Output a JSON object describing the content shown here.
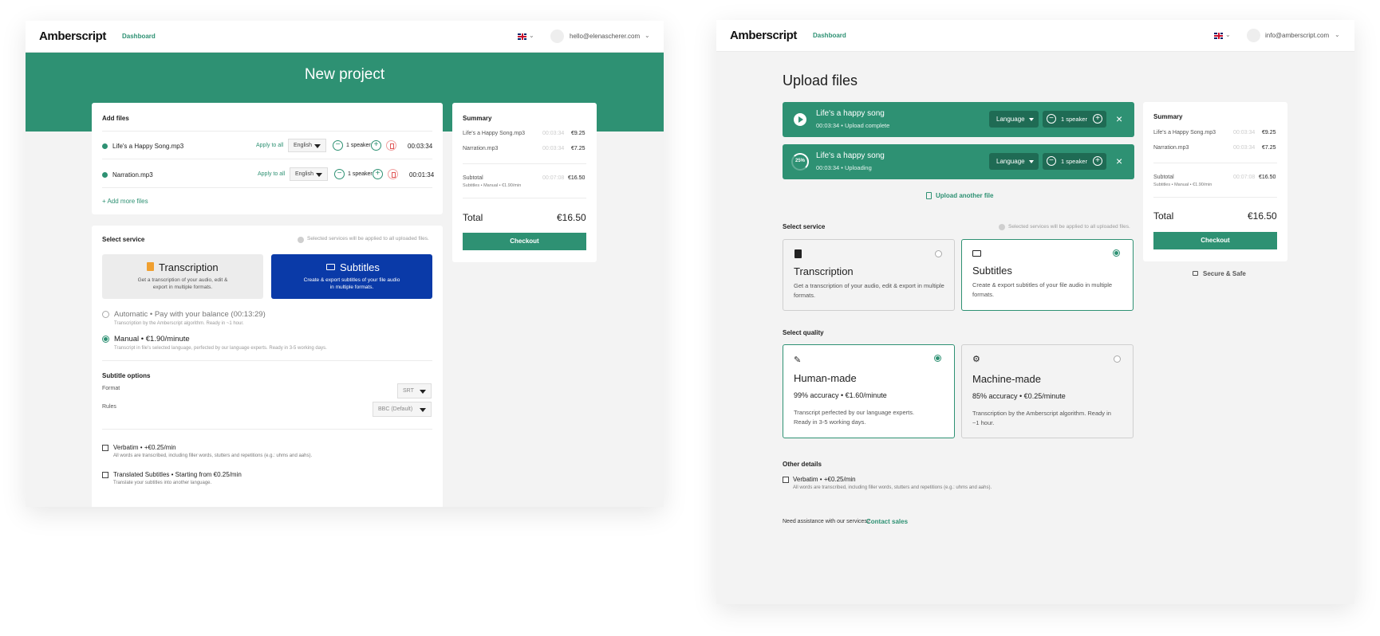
{
  "left": {
    "logo": "Amberscript",
    "nav": "Dashboard",
    "email": "hello@elenascherer.com",
    "title": "New project",
    "add_files": {
      "title": "Add files",
      "files": [
        {
          "name": "Life's a Happy Song.mp3",
          "apply": "Apply to all",
          "language": "English",
          "speaker": "1 speaker",
          "duration": "00:03:34"
        },
        {
          "name": "Narration.mp3",
          "apply": "Apply to all",
          "language": "English",
          "speaker": "1 speaker",
          "duration": "00:01:34"
        }
      ],
      "add_more": "+ Add more files"
    },
    "service": {
      "title": "Select service",
      "note": "Selected services will be applied to all uploaded files.",
      "transcription_title": "Transcription",
      "transcription_desc1": "Get a transcription of your audio, edit &",
      "transcription_desc2": "export in multiple formats.",
      "subtitles_title": "Subtitles",
      "subtitles_desc1": "Create & export subtitles of your file audio",
      "subtitles_desc2": "in multiple formats.",
      "automatic_title": "Automatic • Pay with your balance (00:13:29)",
      "automatic_desc": "Transcription by the Amberscript algorithm. Ready in ~1 hour.",
      "manual_title": "Manual • €1.90/minute",
      "manual_desc": "Transcript in file's selected language, perfected by our language experts. Ready in 3-5 working days."
    },
    "subtitle_options": {
      "title": "Subtitle options",
      "format_label": "Format",
      "format_value": "SRT",
      "rules_label": "Rules",
      "rules_value": "BBC (Default)"
    },
    "verbatim_title": "Verbatim • +€0.25/min",
    "verbatim_desc": "All words are transcribed, including filler words, stutters and repetitions (e.g.: uhms and aahs).",
    "translated_title": "Translated Subtitles • Starting from €0.25/min",
    "translated_desc": "Translate your subtitles into another language.",
    "summary": {
      "title": "Summary",
      "items": [
        {
          "name": "Life's a Happy Song.mp3",
          "duration": "00:03:34",
          "price": "€9.25"
        },
        {
          "name": "Narration.mp3",
          "duration": "00:03:34",
          "price": "€7.25"
        }
      ],
      "subtotal_label": "Subtotal",
      "subtotal_desc": "Subtitles • Manual • €1.90/min",
      "subtotal_duration": "00:07:08",
      "subtotal_price": "€16.50",
      "total_label": "Total",
      "total_price": "€16.50",
      "checkout": "Checkout"
    }
  },
  "right": {
    "logo": "Amberscript",
    "nav": "Dashboard",
    "email": "info@amberscript.com",
    "title": "Upload files",
    "uploads": [
      {
        "name": "Life's a happy song",
        "meta": "00:03:34  •  Upload complete",
        "language": "Language",
        "speaker": "1 speaker"
      },
      {
        "name": "Life's a happy song",
        "meta": "00:03:34  •  Uploading",
        "progress": "25%",
        "language": "Language",
        "speaker": "1 speaker"
      }
    ],
    "upload_another": "Upload another file",
    "service": {
      "title": "Select service",
      "note": "Selected services will be applied to all uploaded files.",
      "transcription_title": "Transcription",
      "transcription_desc": "Get a transcription of your audio, edit & export in multiple formats.",
      "subtitles_title": "Subtitles",
      "subtitles_desc": "Create & export subtitles of your file audio in multiple formats."
    },
    "quality": {
      "title": "Select quality",
      "human_title": "Human-made",
      "human_price": "99% accuracy  •  €1.60/minute",
      "human_desc": "Transcript perfected by our language experts. Ready in 3-5 working days.",
      "machine_title": "Machine-made",
      "machine_price": "85% accuracy  •  €0.25/minute",
      "machine_desc": "Transcription by the Amberscript algorithm. Ready in ~1 hour."
    },
    "other": {
      "title": "Other details",
      "verbatim_title": "Verbatim • +€0.25/min",
      "verbatim_desc": "All words are transcribed, including filler words, stutters and repetitions (e.g.: uhms and aahs)."
    },
    "assist_text": "Need assistance with our services?",
    "contact_sales": "Contact sales",
    "summary": {
      "title": "Summary",
      "items": [
        {
          "name": "Life's a Happy Song.mp3",
          "duration": "00:03:34",
          "price": "€9.25"
        },
        {
          "name": "Narration.mp3",
          "duration": "00:03:34",
          "price": "€7.25"
        }
      ],
      "subtotal_label": "Subtotal",
      "subtotal_desc": "Subtitles • Manual • €1.90/min",
      "subtotal_duration": "00:07:08",
      "subtotal_price": "€16.50",
      "total_label": "Total",
      "total_price": "€16.50",
      "checkout": "Checkout",
      "secure": "Secure & Safe"
    }
  },
  "colors": {
    "brand_green": "#2e9173",
    "dark_green": "#1f6b54",
    "subtitles_blue": "#0a3aa8",
    "transcription_orange": "#f0a030"
  }
}
